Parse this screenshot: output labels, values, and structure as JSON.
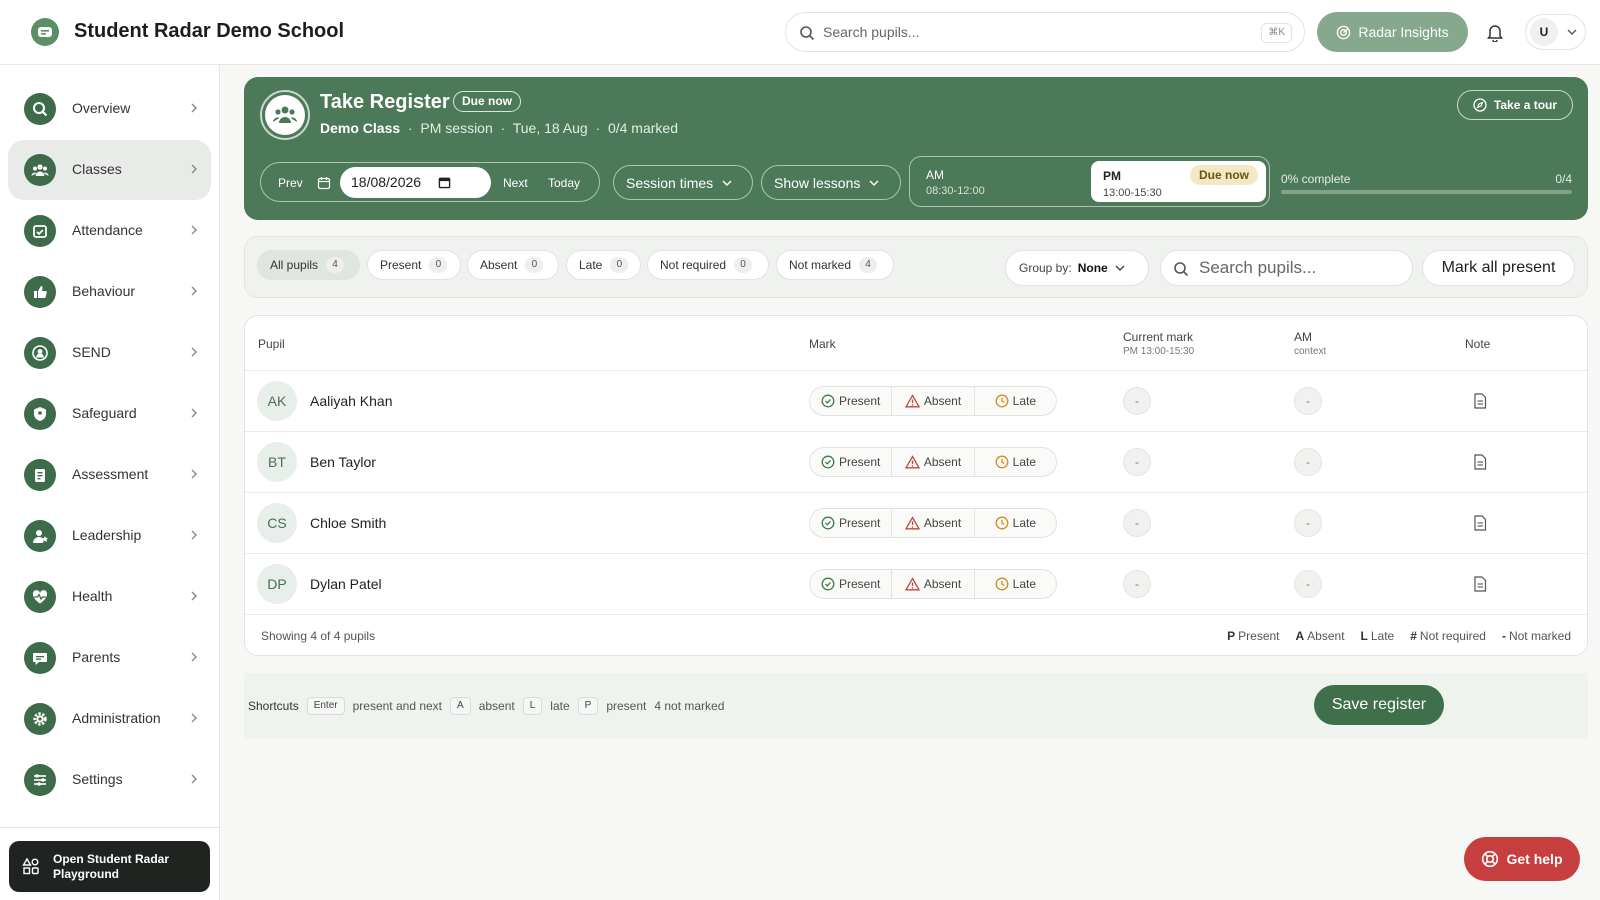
{
  "app": {
    "school_name": "Student Radar Demo School",
    "search_placeholder": "Search pupils...",
    "search_shortcut": "⌘K",
    "insights_label": "Radar Insights",
    "user_initial": "U"
  },
  "sidebar": {
    "items": [
      {
        "label": "Overview",
        "icon": "search-icon",
        "active": false
      },
      {
        "label": "Classes",
        "icon": "people-icon",
        "active": true
      },
      {
        "label": "Attendance",
        "icon": "calendar-check-icon",
        "active": false
      },
      {
        "label": "Behaviour",
        "icon": "thumbs-up-icon",
        "active": false
      },
      {
        "label": "SEND",
        "icon": "user-circle-icon",
        "active": false
      },
      {
        "label": "Safeguard",
        "icon": "shield-icon",
        "active": false
      },
      {
        "label": "Assessment",
        "icon": "clipboard-icon",
        "active": false
      },
      {
        "label": "Leadership",
        "icon": "user-star-icon",
        "active": false
      },
      {
        "label": "Health",
        "icon": "heart-pulse-icon",
        "active": false
      },
      {
        "label": "Parents",
        "icon": "chat-icon",
        "active": false
      },
      {
        "label": "Administration",
        "icon": "gear-icon",
        "active": false
      },
      {
        "label": "Settings",
        "icon": "sliders-icon",
        "active": false
      }
    ],
    "playground_label": "Open Student Radar Playground"
  },
  "register": {
    "title": "Take Register",
    "badge": "Due now",
    "class_name": "Demo Class",
    "session": "PM session",
    "date_text": "Tue, 18 Aug",
    "marked_text": "0/4 marked",
    "tour_label": "Take a tour",
    "prev_label": "Prev",
    "date_value": "18/08/2026",
    "next_label": "Next",
    "today_label": "Today",
    "session_times_label": "Session times",
    "show_lessons_label": "Show lessons",
    "am": {
      "label": "AM",
      "range": "08:30-12:00"
    },
    "pm": {
      "label": "PM",
      "range": "13:00-15:30",
      "badge": "Due now"
    },
    "progress_label": "0% complete",
    "progress_count": "0/4",
    "progress_fraction": 0
  },
  "filters": {
    "chips": [
      {
        "label": "All pupils",
        "count": "4",
        "active": true
      },
      {
        "label": "Present",
        "count": "0",
        "active": false
      },
      {
        "label": "Absent",
        "count": "0",
        "active": false
      },
      {
        "label": "Late",
        "count": "0",
        "active": false
      },
      {
        "label": "Not required",
        "count": "0",
        "active": false
      },
      {
        "label": "Not marked",
        "count": "4",
        "active": false
      }
    ],
    "group_by_label": "Group by:",
    "group_by_value": "None",
    "search_placeholder": "Search pupils...",
    "mark_all_label": "Mark all present"
  },
  "table": {
    "headers": {
      "pupil": "Pupil",
      "mark": "Mark",
      "current_mark": "Current mark",
      "current_mark_sub": "PM 13:00-15:30",
      "am": "AM",
      "am_sub": "context",
      "note": "Note"
    },
    "mark_options": {
      "present": "Present",
      "absent": "Absent",
      "late": "Late"
    },
    "rows": [
      {
        "initials": "AK",
        "name": "Aaliyah Khan",
        "current": "-",
        "am": "-"
      },
      {
        "initials": "BT",
        "name": "Ben Taylor",
        "current": "-",
        "am": "-"
      },
      {
        "initials": "CS",
        "name": "Chloe Smith",
        "current": "-",
        "am": "-"
      },
      {
        "initials": "DP",
        "name": "Dylan Patel",
        "current": "-",
        "am": "-"
      }
    ],
    "footer_count": "Showing 4 of 4 pupils",
    "legend": [
      {
        "key": "P",
        "label": "Present"
      },
      {
        "key": "A",
        "label": "Absent"
      },
      {
        "key": "L",
        "label": "Late"
      },
      {
        "key": "#",
        "label": "Not required"
      },
      {
        "key": "-",
        "label": "Not marked"
      }
    ]
  },
  "shortcuts": {
    "label": "Shortcuts",
    "enter_key": "Enter",
    "enter_text": "present and next",
    "a_key": "A",
    "a_text": "absent",
    "l_key": "L",
    "l_text": "late",
    "p_key": "P",
    "p_text": "present",
    "status": "4 not marked",
    "save_label": "Save register"
  },
  "help_label": "Get help",
  "colors": {
    "brand": "#4c7a58",
    "brand_dark": "#3f6f4b",
    "help": "#c73e3e",
    "due_badge": "#f4e7c4"
  }
}
